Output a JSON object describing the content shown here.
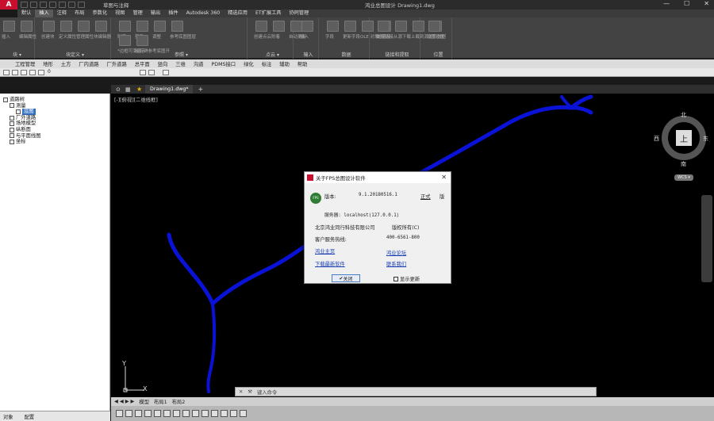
{
  "titlebar": {
    "app_logo": "A",
    "doc_title": "草图与注释",
    "window_title": "鸿业总图设计   Drawing1.dwg",
    "min": "—",
    "max": "☐",
    "close": "✕"
  },
  "tabs": [
    "默认",
    "插入",
    "注释",
    "布局",
    "参数化",
    "视图",
    "管理",
    "输出",
    "插件",
    "Autodesk 360",
    "精选应用",
    "ET扩展工具",
    "协同管理"
  ],
  "active_tab": "插入",
  "ribbon": {
    "groups": [
      {
        "label": "块 ▾",
        "items": [
          "插入",
          "编辑属性"
        ]
      },
      {
        "label": "块定义 ▾",
        "items": [
          "创建块",
          "定义属性",
          "管理属性",
          "块编辑器"
        ]
      },
      {
        "label": "参照 ▾",
        "items": [
          "附着",
          "剪裁",
          "调整",
          "参考底图图层",
          "*边框可变显示*",
          "捕捉到参考底图开"
        ]
      },
      {
        "label": "点云 ▾",
        "items": [
          "创建点云",
          "附着",
          "自动更新"
        ]
      },
      {
        "label": "输入",
        "items": [
          "输入"
        ]
      },
      {
        "label": "数据",
        "items": [
          "字段",
          "更新字段",
          "OLE 对象",
          "超链接"
        ]
      },
      {
        "label": "链接和提取",
        "items": [
          "数据链接",
          "从源下载",
          "上载到源",
          "提取数据"
        ]
      },
      {
        "label": "位置",
        "items": [
          "设置位置"
        ]
      }
    ]
  },
  "menubar": [
    "工程管理",
    "地形",
    "土方",
    "厂内道路",
    "厂外道路",
    "总平面",
    "竖向",
    "三维",
    "沟道",
    "PDMS接口",
    "绿化",
    "标注",
    "辅助",
    "帮助"
  ],
  "layer_value": "0",
  "file_tab": "Drawing1.dwg*",
  "file_tab_add": "+",
  "tree": [
    {
      "label": "道路树",
      "level": 0
    },
    {
      "label": "测量",
      "level": 1
    },
    {
      "label": "底图",
      "level": 2,
      "selected": true
    },
    {
      "label": "厂外道路",
      "level": 1
    },
    {
      "label": "场地模型",
      "level": 1
    },
    {
      "label": "纵断面",
      "level": 1
    },
    {
      "label": "与平面线图",
      "level": 1
    },
    {
      "label": "坐标",
      "level": 1
    }
  ],
  "left_bottom": [
    "对象",
    "配置"
  ],
  "canvas": {
    "view_label": "[-][俯视][二维线框]"
  },
  "viewcube": {
    "north": "北",
    "south": "南",
    "east": "东",
    "west": "西",
    "top": "上",
    "wcs": "WCS ▾"
  },
  "ucs": {
    "y": "Y",
    "x": "X"
  },
  "cmdline": {
    "placeholder": "键入命令"
  },
  "layout_tabs": [
    "模型",
    "布局1",
    "布局2"
  ],
  "dialog": {
    "title": "关于FPS总图设计软件",
    "close": "✕",
    "badge": "FPS",
    "version_label": "版本:",
    "version": "9.1.20180516.1",
    "edition": "正式",
    "edition_suffix": "版",
    "server": "服务器: localhost(127.0.0.1)",
    "company": "北京鸿业同行科技有限公司",
    "copyright": "版权所有(C)",
    "hotline_label": "客户服务热线:",
    "hotline": "400-6561-800",
    "links": [
      "鸿业主页",
      "鸿业论坛",
      "下载最新软件",
      "联系我们"
    ],
    "ok_button": "关闭",
    "checkbox_label": "显示更新"
  },
  "colors": {
    "road": "#0000cc",
    "canvas": "#000000",
    "brand": "#c8102e"
  }
}
